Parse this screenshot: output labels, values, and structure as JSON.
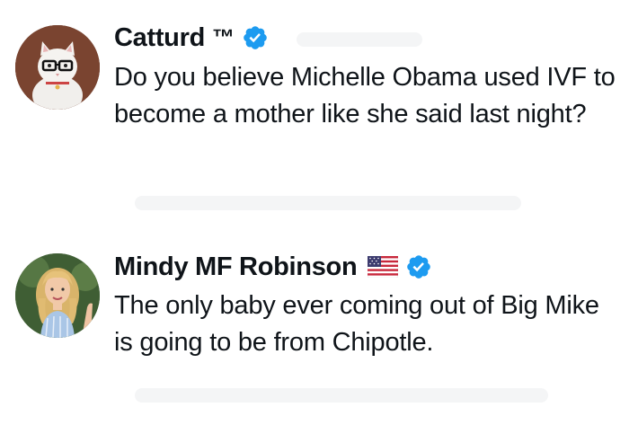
{
  "tweets": [
    {
      "author": "Catturd",
      "author_suffix": "™",
      "verified": true,
      "avatar": "cat-with-glasses-avatar",
      "text": "Do you believe Michelle Obama used IVF to become a mother like she said last night?"
    },
    {
      "author": "Mindy MF Robinson",
      "flag": "us-flag-emoji",
      "verified": true,
      "avatar": "blonde-woman-avatar",
      "text": "The only baby ever coming out of Big Mike is going to be from Chipotle."
    }
  ],
  "colors": {
    "verified_blue": "#1d9bf0",
    "text": "#0f1419"
  }
}
